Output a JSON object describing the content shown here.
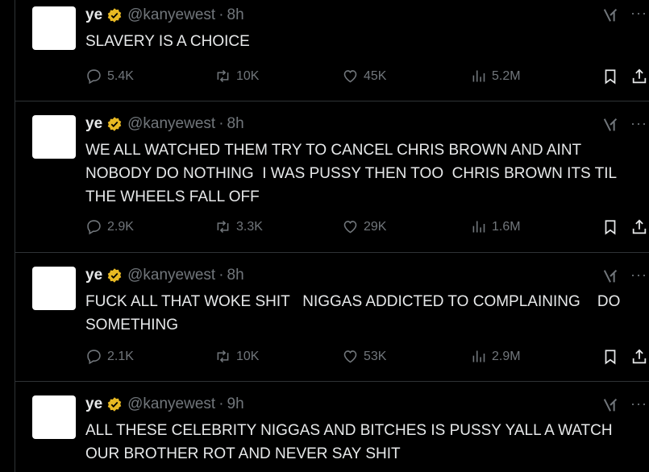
{
  "tweets": [
    {
      "name": "ye",
      "handle": "@kanyewest",
      "time": "8h",
      "text": "SLAVERY IS A CHOICE",
      "replies": "5.4K",
      "reposts": "10K",
      "likes": "45K",
      "views": "5.2M"
    },
    {
      "name": "ye",
      "handle": "@kanyewest",
      "time": "8h",
      "text": "WE ALL WATCHED THEM TRY TO CANCEL CHRIS BROWN AND AINT NOBODY DO NOTHING  I WAS PUSSY THEN TOO  CHRIS BROWN ITS TIL THE WHEELS FALL OFF",
      "replies": "2.9K",
      "reposts": "3.3K",
      "likes": "29K",
      "views": "1.6M"
    },
    {
      "name": "ye",
      "handle": "@kanyewest",
      "time": "8h",
      "text": "FUCK ALL THAT WOKE SHIT   NIGGAS ADDICTED TO COMPLAINING    DO SOMETHING",
      "replies": "2.1K",
      "reposts": "10K",
      "likes": "53K",
      "views": "2.9M"
    },
    {
      "name": "ye",
      "handle": "@kanyewest",
      "time": "9h",
      "text": "ALL THESE CELEBRITY NIGGAS AND BITCHES IS PUSSY YALL A WATCH OUR BROTHER ROT AND NEVER SAY SHIT",
      "replies": "",
      "reposts": "",
      "likes": "",
      "views": ""
    }
  ],
  "icons": {
    "verified": "verified-badge-icon",
    "grok": "grok-icon",
    "more": "more-icon",
    "reply": "reply-icon",
    "repost": "repost-icon",
    "like": "like-icon",
    "views": "views-icon",
    "bookmark": "bookmark-icon",
    "share": "share-icon"
  },
  "colors": {
    "background": "#000000",
    "text": "#e7e9ea",
    "muted": "#71767b",
    "border": "#2f3336",
    "verified_gold": "#e8b923"
  },
  "more_label": "···"
}
